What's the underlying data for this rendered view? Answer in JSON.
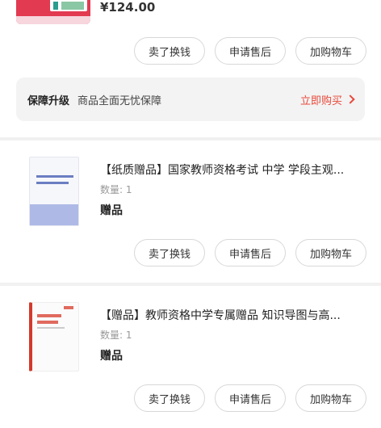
{
  "order_top": {
    "price": "¥124.00",
    "buttons": [
      "卖了换钱",
      "申请售后",
      "加购物车"
    ]
  },
  "guarantee": {
    "title": "保障升级",
    "desc": "商品全面无忧保障",
    "buy_label": "立即购买"
  },
  "items": [
    {
      "title": "【纸质赠品】国家教师资格考试 中学 学段主观...",
      "qty": "数量: 1",
      "tag": "赠品",
      "buttons": [
        "卖了换钱",
        "申请售后",
        "加购物车"
      ]
    },
    {
      "title": "【赠品】教师资格中学专属赠品 知识导图与高...",
      "qty": "数量: 1",
      "tag": "赠品",
      "buttons": [
        "卖了换钱",
        "申请售后",
        "加购物车"
      ]
    }
  ],
  "colors": {
    "accent": "#e8483b",
    "background": "#f1f1f1"
  }
}
